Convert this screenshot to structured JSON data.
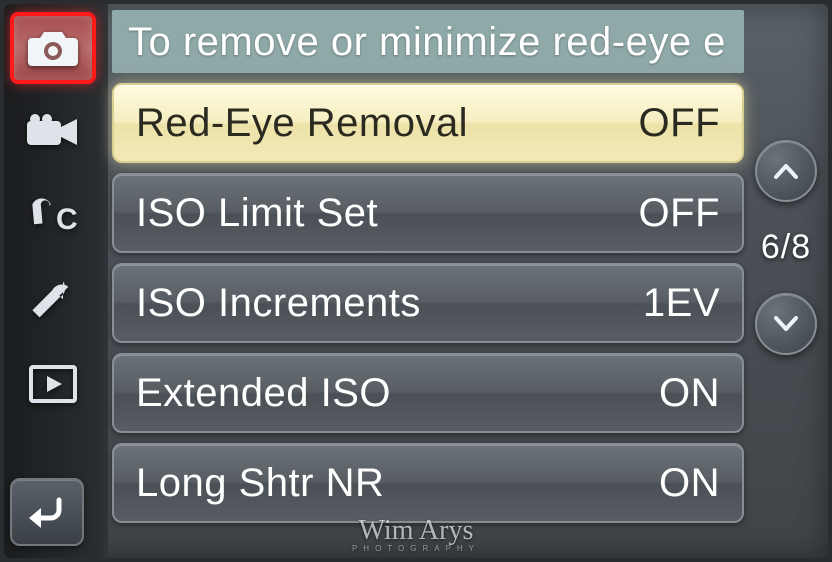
{
  "hint": "To remove or minimize red-eye e",
  "sidebar": {
    "tabs": [
      {
        "name": "photo",
        "selected": true
      },
      {
        "name": "video",
        "selected": false
      },
      {
        "name": "custom",
        "selected": false
      },
      {
        "name": "setup",
        "selected": false
      },
      {
        "name": "playback",
        "selected": false
      }
    ]
  },
  "menu": {
    "items": [
      {
        "label": "Red-Eye Removal",
        "value": "OFF",
        "selected": true
      },
      {
        "label": "ISO Limit Set",
        "value": "OFF",
        "selected": false
      },
      {
        "label": "ISO Increments",
        "value": "1EV",
        "selected": false
      },
      {
        "label": "Extended ISO",
        "value": "ON",
        "selected": false
      },
      {
        "label": "Long Shtr NR",
        "value": "ON",
        "selected": false
      }
    ]
  },
  "pagination": {
    "current": 6,
    "total": 8,
    "display": "6/8"
  },
  "watermark": {
    "name": "Wim Arys",
    "sub": "PHOTOGRAPHY"
  }
}
